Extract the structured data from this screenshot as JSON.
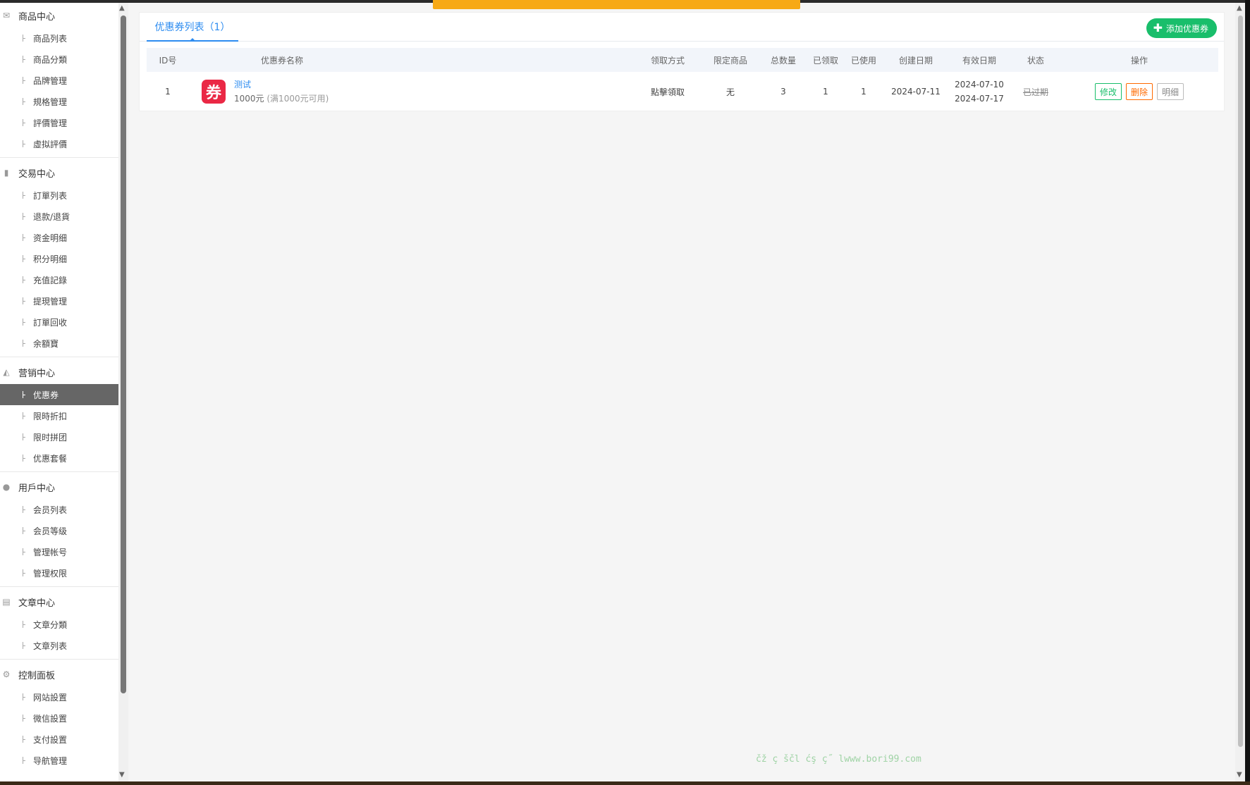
{
  "sidebar": {
    "groups": [
      {
        "icon": "envelope-icon",
        "glyph": "✉",
        "title": "商品中心",
        "items": [
          "商品列表",
          "商品分類",
          "品牌管理",
          "規格管理",
          "評價管理",
          "虛拟評價"
        ]
      },
      {
        "icon": "bar-chart-icon",
        "glyph": "▮",
        "title": "交易中心",
        "items": [
          "訂單列表",
          "退款/退貨",
          "资金明细",
          "积分明细",
          "充值記錄",
          "提現管理",
          "訂單回收",
          "余額寶"
        ]
      },
      {
        "icon": "area-chart-icon",
        "glyph": "◭",
        "title": "营销中心",
        "items": [
          "优惠券",
          "限時折扣",
          "限时拼团",
          "优惠套餐"
        ]
      },
      {
        "icon": "user-icon",
        "glyph": "●",
        "title": "用戶中心",
        "items": [
          "会员列表",
          "会员等级",
          "管理帐号",
          "管理权限"
        ]
      },
      {
        "icon": "document-icon",
        "glyph": "▤",
        "title": "文章中心",
        "items": [
          "文章分類",
          "文章列表"
        ]
      },
      {
        "icon": "gear-icon",
        "glyph": "⚙",
        "title": "控制面板",
        "items": [
          "网站設置",
          "微信設置",
          "支付設置",
          "导航管理"
        ]
      }
    ],
    "active_item": "优惠券"
  },
  "tab": {
    "label": "优惠券列表（1）"
  },
  "add_button": {
    "label": "添加优惠券"
  },
  "table": {
    "headers": [
      "ID号",
      "优惠券名称",
      "领取方式",
      "限定商品",
      "总数量",
      "已领取",
      "已使用",
      "创建日期",
      "有效日期",
      "状态",
      "操作"
    ],
    "rows": [
      {
        "id": "1",
        "badge": "券",
        "name": "测试",
        "amount": "1000元",
        "condition": "(满1000元可用)",
        "method": "點擊領取",
        "limit_goods": "无",
        "total": "3",
        "received": "1",
        "used": "1",
        "created": "2024-07-11",
        "valid_from": "2024-07-10",
        "valid_to": "2024-07-17",
        "status": "已过期",
        "ops": {
          "edit": "修改",
          "delete": "删除",
          "detail": "明细"
        }
      }
    ]
  },
  "footer_text": "čž ç ščl ćş ç˝ lwww.bori99.com",
  "colors": {
    "accent": "#2d8cf0",
    "green": "#19be6b",
    "orange": "#ff6a00",
    "badge": "#ea2845",
    "topbar": "#f7a916"
  }
}
